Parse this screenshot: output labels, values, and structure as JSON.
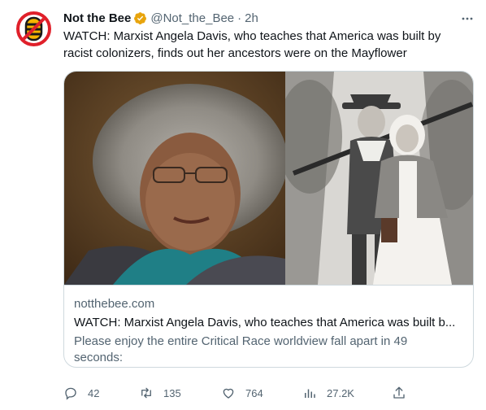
{
  "tweet": {
    "avatar_icon": "bee-logo-icon",
    "display_name": "Not the Bee",
    "verified_icon": "verified-badge-icon",
    "verified_color": "#e8a40c",
    "handle": "@Not_the_Bee",
    "separator": "·",
    "time": "2h",
    "more_icon": "more-options-icon",
    "text": "WATCH: Marxist Angela Davis, who teaches that America was built by racist colonizers, finds out her ancestors were on the Mayflower"
  },
  "card": {
    "image_left": "portrait-photo",
    "image_right": "pilgrim-illustration",
    "domain": "notthebee.com",
    "title": "WATCH: Marxist Angela Davis, who teaches that America was built b...",
    "description": "Please enjoy the entire Critical Race worldview fall apart in 49 seconds:"
  },
  "actions": {
    "reply": {
      "icon": "reply-icon",
      "count": "42"
    },
    "retweet": {
      "icon": "retweet-icon",
      "count": "135"
    },
    "like": {
      "icon": "heart-icon",
      "count": "764"
    },
    "views": {
      "icon": "views-chart-icon",
      "count": "27.2K"
    },
    "share": {
      "icon": "share-icon"
    }
  },
  "colors": {
    "text_primary": "#0f1419",
    "text_secondary": "#536471",
    "border": "#cfd9de",
    "brand_red": "#e0202a"
  }
}
